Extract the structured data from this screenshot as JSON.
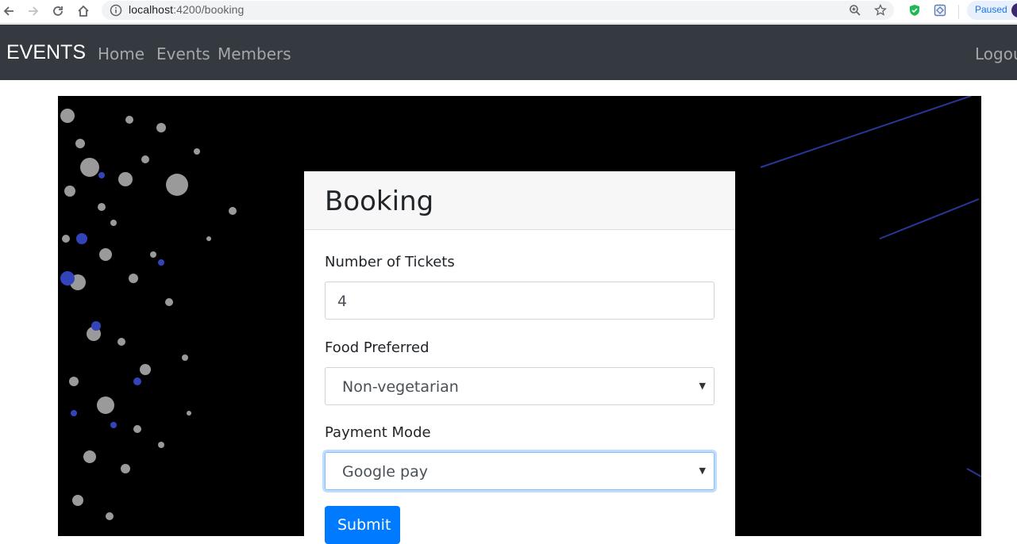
{
  "browser": {
    "url_host": "localhost",
    "url_rest": ":4200/booking",
    "profile_status": "Paused"
  },
  "navbar": {
    "brand": "EVENTS",
    "links": [
      "Home",
      "Events",
      "Members"
    ],
    "logout": "Logout"
  },
  "booking": {
    "title": "Booking",
    "tickets_label": "Number of Tickets",
    "tickets_value": "4",
    "food_label": "Food Preferred",
    "food_value": "Non-vegetarian",
    "payment_label": "Payment Mode",
    "payment_value": "Google pay",
    "submit_label": "Submit"
  },
  "colors": {
    "navbar_bg": "#343a40",
    "primary": "#007bff",
    "focus_ring": "#80bdff"
  }
}
